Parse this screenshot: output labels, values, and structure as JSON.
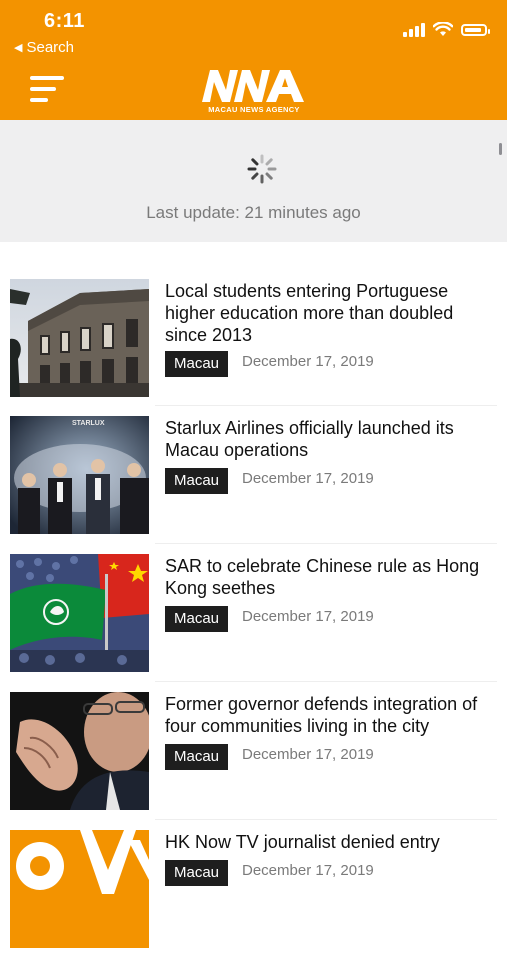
{
  "status_bar": {
    "time": "6:11",
    "back_label": "Search"
  },
  "header": {
    "logo_text": "MACAU NEWS AGENCY",
    "accent_color": "#f39300"
  },
  "refresh": {
    "last_update": "Last update: 21 minutes ago"
  },
  "articles": [
    {
      "title": "Local students entering Portuguese higher education more than doubled since 2013",
      "category": "Macau",
      "date": "December 17, 2019"
    },
    {
      "title": "Starlux Airlines officially launched its Macau operations",
      "category": "Macau",
      "date": "December 17, 2019",
      "thumb_text": "STARLUX"
    },
    {
      "title": "SAR to celebrate Chinese rule as Hong Kong seethes",
      "category": "Macau",
      "date": "December 17, 2019"
    },
    {
      "title": "Former governor defends integration of four communities living in the city",
      "category": "Macau",
      "date": "December 17, 2019"
    },
    {
      "title": "HK Now TV journalist denied entry",
      "category": "Macau",
      "date": "December 17, 2019"
    }
  ]
}
